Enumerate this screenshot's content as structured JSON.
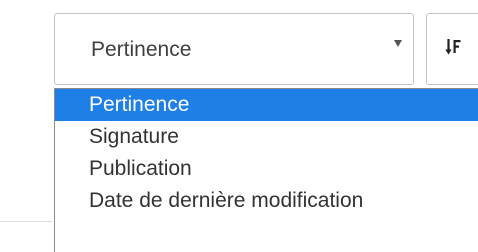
{
  "sort_select": {
    "value": "Pertinence",
    "options": [
      "Pertinence",
      "Signature",
      "Publication",
      "Date de dernière modification"
    ],
    "selected_index": 0
  },
  "sort_button": {
    "icon": "sort-descending-icon"
  },
  "colors": {
    "selected_background": "#1e7fe6",
    "selected_text": "#ffffff",
    "text": "#333333",
    "border": "#c4c4c4"
  }
}
